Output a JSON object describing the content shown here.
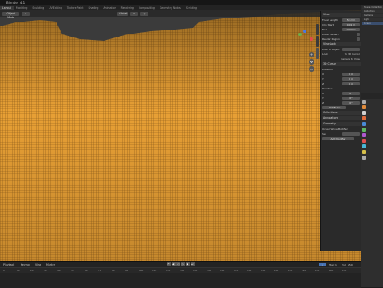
{
  "title": "Blender 4.1",
  "workspaces": [
    "Layout",
    "Modeling",
    "Sculpting",
    "UV Editing",
    "Texture Paint",
    "Shading",
    "Animation",
    "Rendering",
    "Compositing",
    "Geometry Nodes",
    "Scripting"
  ],
  "active_workspace": "Layout",
  "viewport": {
    "mode": "Object Mode",
    "view_label": "Global",
    "terrain_color": "#e8a035",
    "background_color": "#3b3b3b"
  },
  "npanel": {
    "tabs": [
      "Item",
      "Tool",
      "View"
    ],
    "sections": {
      "view": "View",
      "focal_length_label": "Focal Length",
      "focal_length": "50 mm",
      "clip_start_label": "Clip Start",
      "clip_start": "0.01 m",
      "clip_end_label": "End",
      "clip_end": "1000 m",
      "local_camera_label": "Local Camera",
      "render_region_label": "Render Region",
      "view_lock": "View Lock",
      "lock_to_object_label": "Lock to Object",
      "lock_label": "Lock",
      "to_3d_cursor": "To 3D Cursor",
      "camera_to_view": "Camera to View",
      "cursor_3d": "3D Cursor",
      "location_label": "Location",
      "x_label": "X",
      "x_val": "0 m",
      "y_label": "Y",
      "y_val": "0 m",
      "z_label": "Z",
      "z_val": "0 m",
      "rotation_label": "Rotation",
      "rx_val": "0°",
      "ry_val": "0°",
      "rz_val": "0°",
      "rotation_mode": "XYZ Euler",
      "collections": "Collections",
      "annotations": "Annotations",
      "geometry": "Geometry",
      "wave_label": "Ocean Wave Modifier",
      "set_label": "Set",
      "add_btn": "Add Modifier"
    }
  },
  "timeline": {
    "playback": "Playback",
    "keying": "Keying",
    "view": "View",
    "marker": "Marker",
    "current_frame": "1",
    "start_label": "Start",
    "start": "1",
    "end_label": "End",
    "end": "250",
    "ticks": [
      "0",
      "10",
      "20",
      "30",
      "40",
      "50",
      "60",
      "70",
      "80",
      "90",
      "100",
      "110",
      "120",
      "130",
      "140",
      "150",
      "160",
      "170",
      "180",
      "190",
      "200",
      "210",
      "220",
      "230",
      "240",
      "250"
    ]
  },
  "outliner": {
    "rows": [
      "Scene Collection",
      "Collection",
      "Camera",
      "Light",
      "Ocean"
    ]
  },
  "properties": {
    "tab_colors": [
      "#aaaaaa",
      "#e08a3a",
      "#d0d0d0",
      "#e06a3a",
      "#4a8ad6",
      "#5fb85f",
      "#b05ad0",
      "#e05050",
      "#4ab6d6",
      "#d6c04a",
      "#aaaaaa"
    ]
  }
}
